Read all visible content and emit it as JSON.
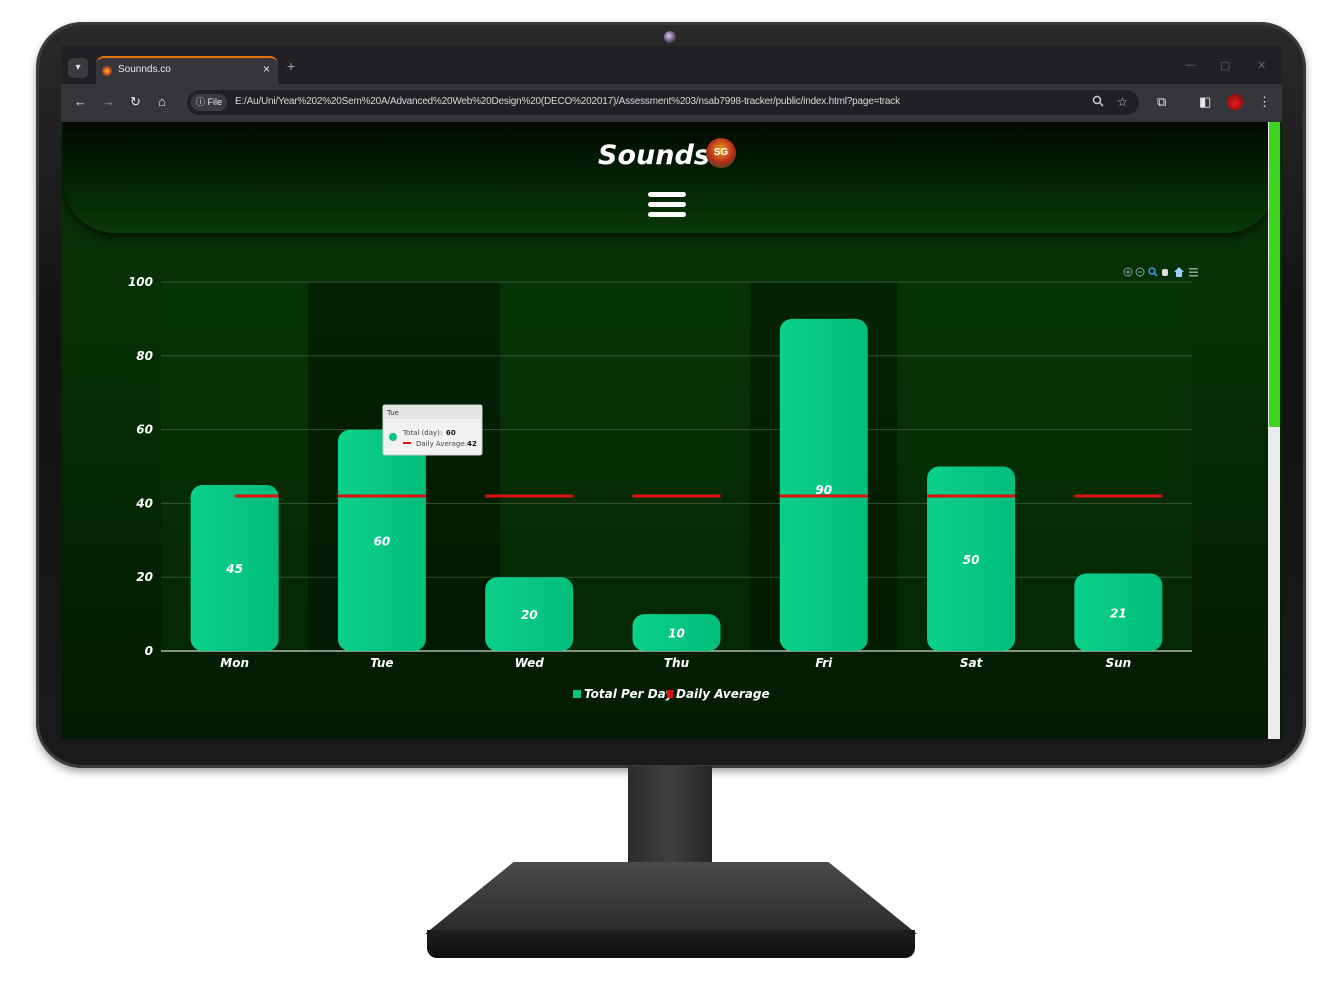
{
  "browser": {
    "tab_title": "Sounnds.co",
    "tab_close": "×",
    "new_tab": "+",
    "file_chip": "ⓘ File",
    "url": "E:/Au/Uni/Year%202%20Sem%20A/Advanced%20Web%20Design%20(DECO%202017)/Assessment%203/nsab7998-tracker/public/index.html?page=track",
    "nav_icons": {
      "back": "←",
      "forward": "→",
      "reload": "↻",
      "home": "⌂"
    },
    "window_controls": {
      "minimize": "—",
      "restore": "▢",
      "close": "✕"
    }
  },
  "site": {
    "brand": "Sounds",
    "logo_text": "SG"
  },
  "colors": {
    "bar": "#02c681",
    "avg_line": "#e01010",
    "accent_scrollbar": "#3cd61e"
  },
  "chart_data": {
    "type": "bar",
    "categories": [
      "Mon",
      "Tue",
      "Wed",
      "Thu",
      "Fri",
      "Sat",
      "Sun"
    ],
    "series": [
      {
        "name": "Total Per Day",
        "type": "bar",
        "values": [
          45,
          60,
          20,
          10,
          90,
          50,
          21
        ]
      },
      {
        "name": "Daily Average",
        "type": "line",
        "values": [
          42,
          42,
          42,
          42,
          42,
          42,
          42
        ]
      }
    ],
    "data_labels": [
      "45",
      "60",
      "20",
      "10",
      "90",
      "50",
      "21"
    ],
    "ylim": [
      0,
      100
    ],
    "yticks": [
      "0",
      "20",
      "40",
      "60",
      "80",
      "100"
    ],
    "grid": true,
    "legend": "bottom-center",
    "tooltip": {
      "title": "Tue",
      "total_label": "Total (day):",
      "total_value": "60",
      "avg_label": "Daily Average:",
      "avg_value": "42"
    }
  }
}
